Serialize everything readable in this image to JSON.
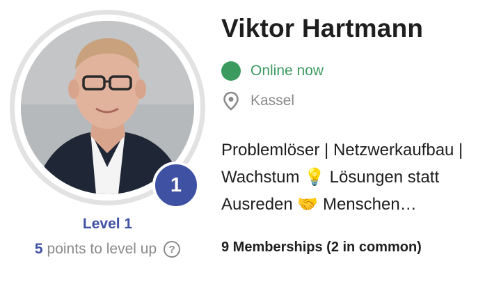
{
  "profile": {
    "name": "Viktor Hartmann",
    "status": "Online now",
    "location": "Kassel",
    "bio": "Problemlöser | Netzwerkaufbau | Wachstum 💡 Lösungen statt Ausreden 🤝 Menschen…",
    "memberships": "9 Memberships (2 in common)",
    "avatar_icon": "profile-photo"
  },
  "level": {
    "badge_number": "1",
    "label": "Level 1",
    "points": "5",
    "points_suffix": "points to level up",
    "help_icon": "question-circle-icon"
  },
  "colors": {
    "accent": "#3f51a3",
    "online": "#3c9a5f",
    "muted": "#8a8a8a"
  }
}
